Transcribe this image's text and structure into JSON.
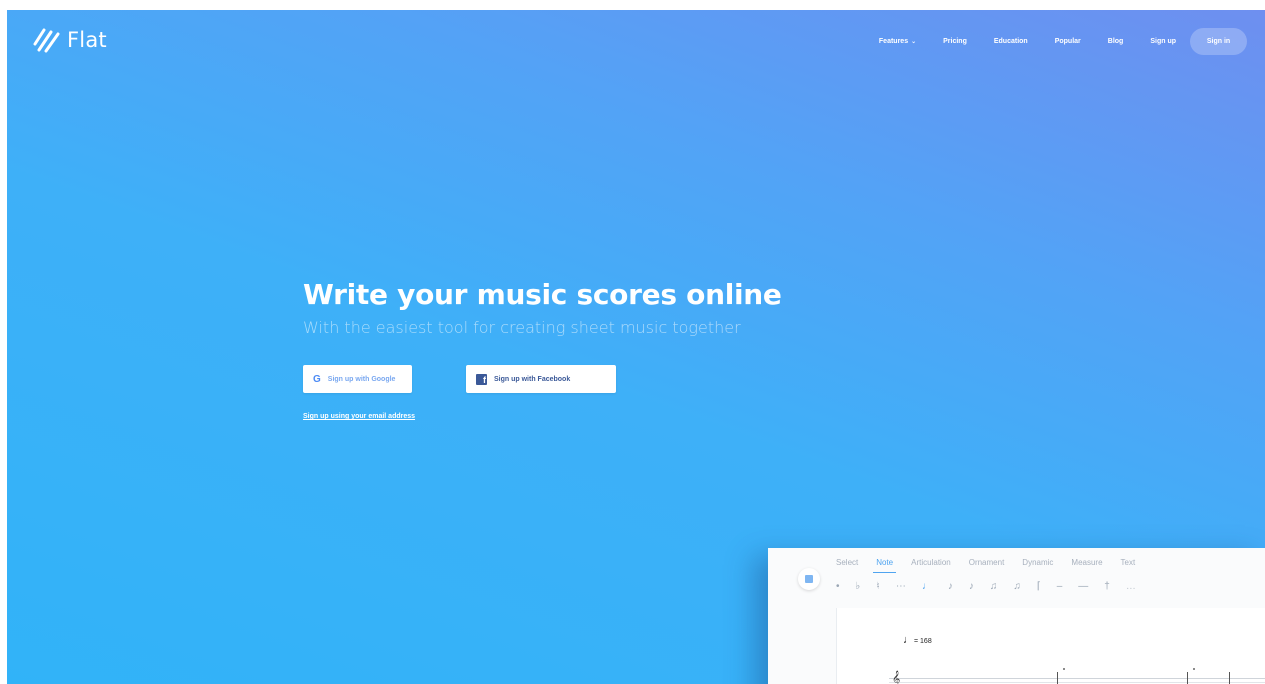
{
  "brand": {
    "name": "Flat"
  },
  "nav": {
    "items": [
      "Features",
      "Pricing",
      "Education",
      "Popular",
      "Blog",
      "Sign up"
    ],
    "signin": "Sign in"
  },
  "hero": {
    "title": "Write your music scores online",
    "subtitle": "With the easiest tool for creating sheet music together",
    "google_button": "Sign up with Google",
    "facebook_button": "Sign up with Facebook",
    "email_link": "Sign up using your email address"
  },
  "editor": {
    "tabs": [
      "Select",
      "Note",
      "Articulation",
      "Ornament",
      "Dynamic",
      "Measure",
      "Text"
    ],
    "active_tab": "Note",
    "tempo": "= 168"
  },
  "colors": {
    "gradient_start": "#6e8ff0",
    "gradient_end": "#31b3f8",
    "accent": "#4fa4f0",
    "facebook": "#3b5998"
  }
}
